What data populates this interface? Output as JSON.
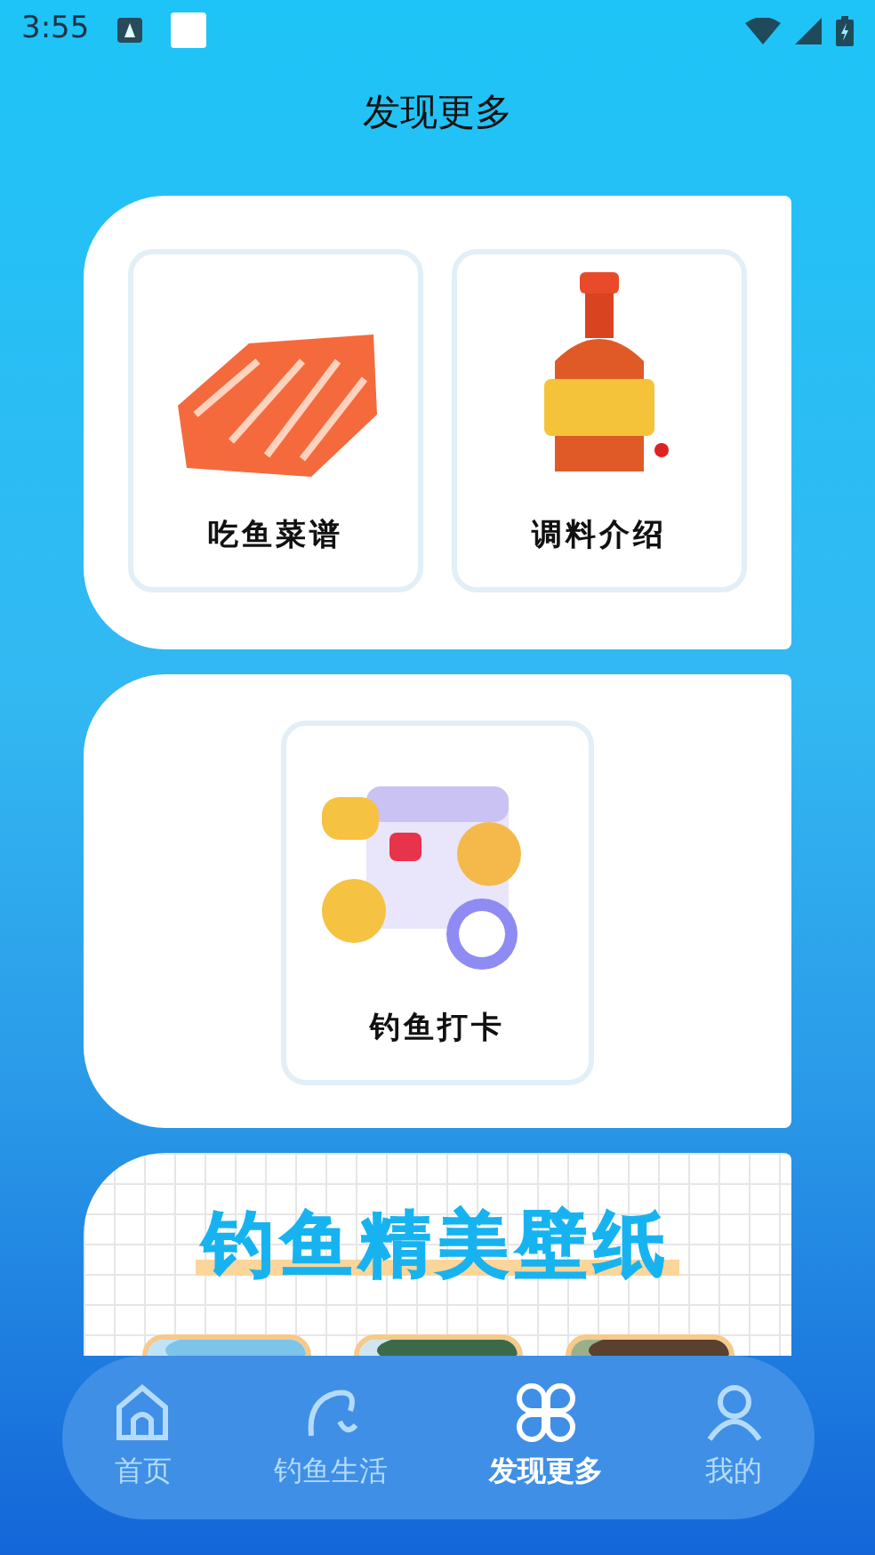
{
  "status_bar": {
    "time": "3:55"
  },
  "title": "发现更多",
  "sections": [
    {
      "kind": "tiles",
      "items": [
        {
          "label": "吃鱼菜谱"
        },
        {
          "label": "调料介绍"
        }
      ]
    },
    {
      "kind": "tiles",
      "items": [
        {
          "label": "钓鱼打卡"
        }
      ]
    },
    {
      "kind": "banner",
      "title": "钓鱼精美壁纸"
    }
  ],
  "tabs": [
    {
      "label": "首页",
      "selected": false
    },
    {
      "label": "钓鱼生活",
      "selected": false
    },
    {
      "label": "发现更多",
      "selected": true
    },
    {
      "label": "我的",
      "selected": false
    }
  ]
}
